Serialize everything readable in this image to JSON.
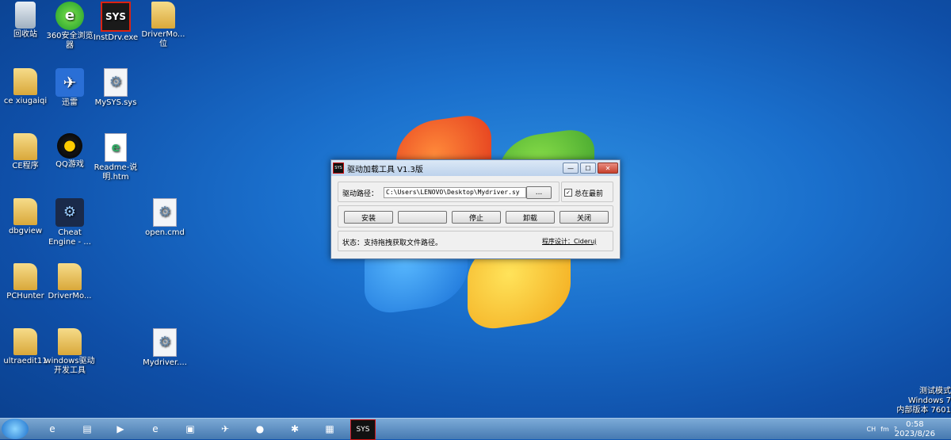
{
  "desktop": {
    "icons": [
      {
        "label": "回收站",
        "icon": "recycle-bin-icon"
      },
      {
        "label": "360安全浏览器",
        "icon": "browser-icon"
      },
      {
        "label": "InstDrv.exe",
        "icon": "sys-icon",
        "glyph": "SYS"
      },
      {
        "label": "DriverMo...位",
        "icon": "folder-icon"
      },
      {
        "label": "ce xiugaiqi",
        "icon": "folder-icon"
      },
      {
        "label": "迅雷",
        "icon": "bird-icon"
      },
      {
        "label": "MySYS.sys",
        "icon": "gear-file-icon"
      },
      {
        "label": "CE程序",
        "icon": "folder-icon"
      },
      {
        "label": "QQ游戏",
        "icon": "penguin-icon"
      },
      {
        "label": "Readme-说明.htm",
        "icon": "html-file-icon"
      },
      {
        "label": "dbgview",
        "icon": "folder-icon"
      },
      {
        "label": "Cheat Engine - ...",
        "icon": "cheat-engine-icon"
      },
      {
        "label": "open.cmd",
        "icon": "gear-file-icon"
      },
      {
        "label": "PCHunter",
        "icon": "folder-icon"
      },
      {
        "label": "DriverMo...",
        "icon": "folder-icon"
      },
      {
        "label": "ultraedit11",
        "icon": "folder-icon"
      },
      {
        "label": "windows驱动开发工具",
        "icon": "folder-icon"
      },
      {
        "label": "Mydriver....",
        "icon": "gear-file-icon"
      }
    ]
  },
  "dialog": {
    "title": "驱动加载工具 V1.3版",
    "app_icon_text": "SYS",
    "path_label": "驱动路径：",
    "path_value": "C:\\Users\\LENOVO\\Desktop\\Mydriver.sy",
    "browse_label": "...",
    "always_on_top_label": "总在最前",
    "always_on_top_checked": "✓",
    "buttons": {
      "install": "安装",
      "blank": "",
      "stop": "停止",
      "uninstall": "卸载",
      "close": "关闭"
    },
    "status_text": "状态：支持拖拽获取文件路径。",
    "credit": "程序设计：Cideruj"
  },
  "taskbar": {
    "items": [
      "IE",
      "Folder",
      "Media",
      "Browser",
      "Cmd",
      "Bird",
      "Penguin",
      "Bug",
      "Terminal",
      "SYS"
    ],
    "tray": [
      "CH",
      "fm",
      "?"
    ],
    "clock_time": "0:58",
    "clock_date": "2023/8/26"
  },
  "watermark": {
    "line1": "测试模式",
    "line2": "Windows 7",
    "line3": "内部版本 7601"
  }
}
